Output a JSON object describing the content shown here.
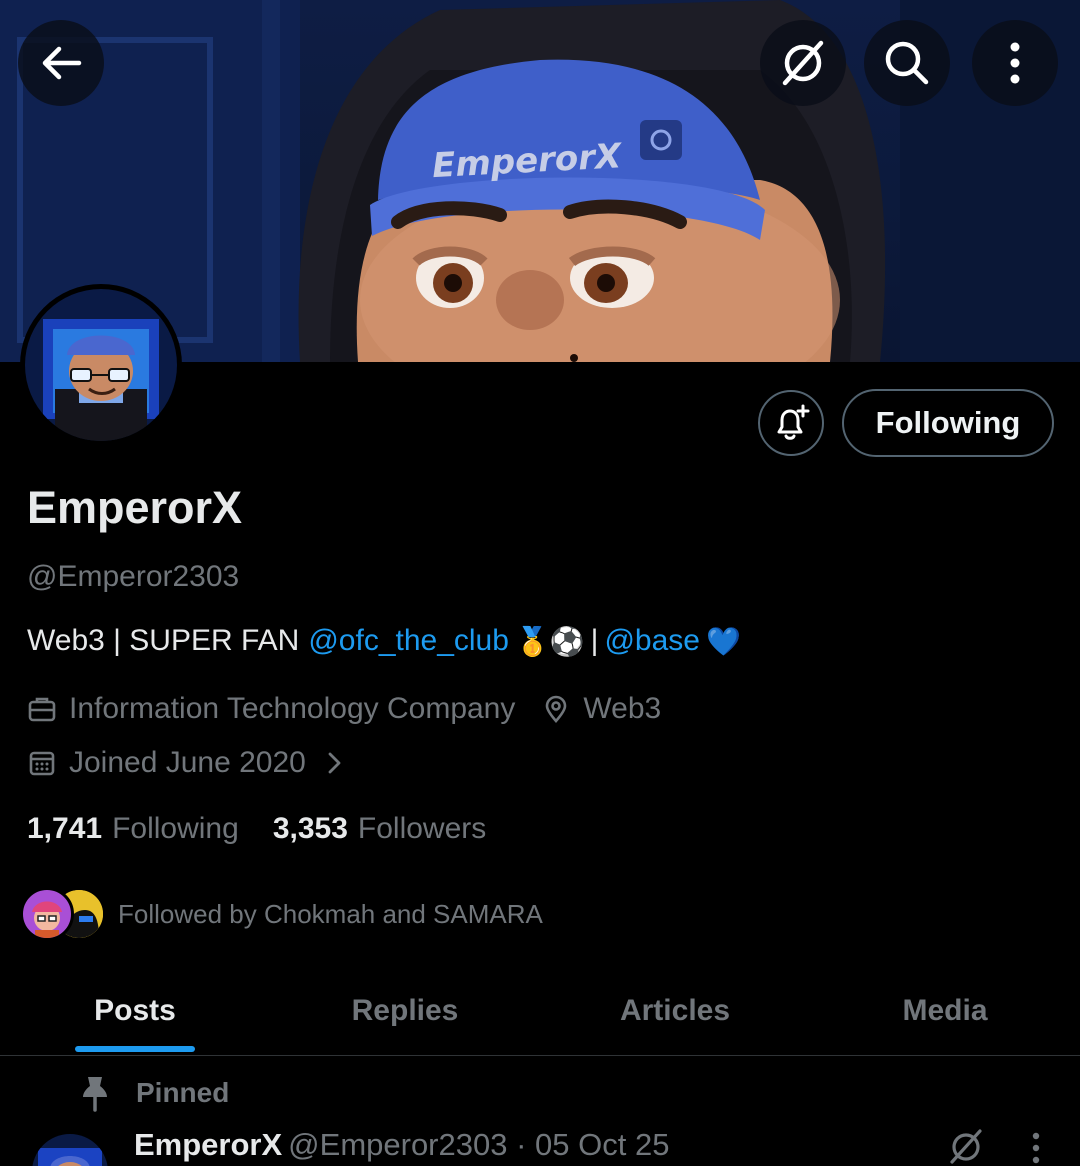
{
  "banner": {
    "cap_text": "EmperorX"
  },
  "top_bar": {
    "back_icon": "arrow-left-icon",
    "grok_icon": "grok-icon",
    "search_icon": "search-icon",
    "more_icon": "more-vertical-icon"
  },
  "profile": {
    "display_name": "EmperorX",
    "handle": "@Emperor2303",
    "follow_button_label": "Following",
    "bio": {
      "text_1": "Web3 | SUPER FAN",
      "mention_1": "@ofc_the_club",
      "emoji_1": "🥇⚽",
      "separator": "|",
      "mention_2": "@base",
      "emoji_2": "💙"
    },
    "category": "Information Technology Company",
    "location": "Web3",
    "joined": "Joined June 2020",
    "following_count": "1,741",
    "following_label": "Following",
    "followers_count": "3,353",
    "followers_label": "Followers",
    "followed_by": "Followed by Chokmah and SAMARA"
  },
  "tabs": [
    {
      "label": "Posts",
      "active": true
    },
    {
      "label": "Replies",
      "active": false
    },
    {
      "label": "Articles",
      "active": false
    },
    {
      "label": "Media",
      "active": false
    }
  ],
  "pinned_post": {
    "pinned_label": "Pinned",
    "author_name": "EmperorX",
    "author_handle_date": "@Emperor2303 · 05 Oct 25"
  },
  "colors": {
    "accent": "#1d9bf0",
    "muted_text": "#71767b",
    "primary_text": "#e7e9ea",
    "background": "#000000"
  }
}
